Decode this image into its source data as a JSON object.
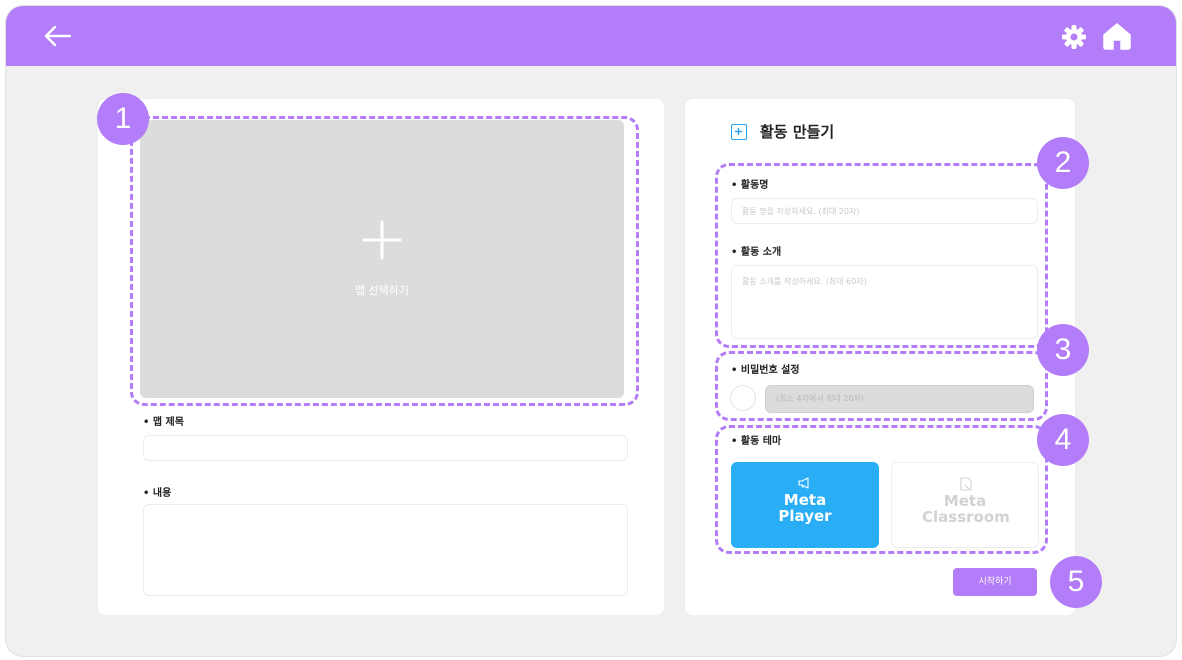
{
  "header": {
    "back_icon": "arrow-left-icon",
    "settings_icon": "gear-icon",
    "home_icon": "home-icon",
    "bar_color": "#b37cf8"
  },
  "left_panel": {
    "map_select_label": "맵 선택하기",
    "map_title_label": "• 맵 제목",
    "map_title_value": "",
    "content_label": "• 내용",
    "content_value": ""
  },
  "right_panel": {
    "title": "활동 만들기",
    "activity_name_label": "• 활동명",
    "activity_name_placeholder": "활동 명을 작성하세요. (최대 20자)",
    "activity_intro_label": "• 활동 소개",
    "activity_intro_placeholder": "활동 소개를 작성하세요. (최대 60자)",
    "password_label": "• 비밀번호 설정",
    "password_placeholder": "(최소 4자에서 최대 20자)",
    "theme_label": "• 활동 테마",
    "themes": [
      {
        "name": "Meta Player",
        "selected": true,
        "icon": "megaphone-icon"
      },
      {
        "name": "Meta Classroom",
        "selected": false,
        "icon": "document-icon"
      }
    ],
    "start_button": "시작하기"
  },
  "badges": [
    "1",
    "2",
    "3",
    "4",
    "5"
  ],
  "colors": {
    "accent": "#b37cf8",
    "theme_selected": "#29adf5"
  }
}
